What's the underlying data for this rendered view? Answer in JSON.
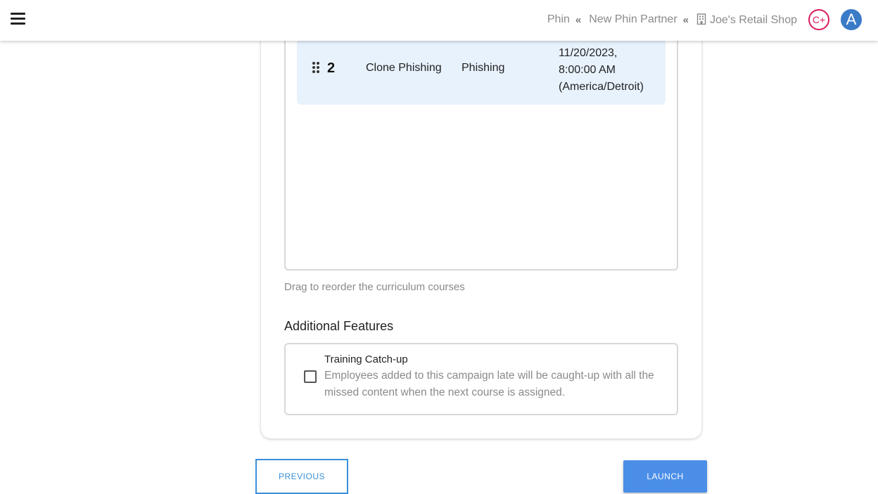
{
  "header": {
    "breadcrumb": [
      {
        "label": "Phin"
      },
      {
        "label": "New Phin Partner"
      },
      {
        "label": "Joe's Retail Shop",
        "icon": "building-icon"
      }
    ],
    "separator": "«",
    "cplus_label": "C+",
    "avatar_initial": "A",
    "colors": {
      "cplus": "#d81b60",
      "avatar": "#3a7bc8"
    }
  },
  "curriculum": {
    "rows": [
      {
        "number": "2",
        "name": "Clone Phishing",
        "type": "Phishing",
        "date_lines": [
          "11/20/2023,",
          "8:00:00 AM",
          "(America/Detroit)"
        ]
      }
    ],
    "hint": "Drag to reorder the curriculum courses"
  },
  "additional_features": {
    "title": "Additional Features",
    "features": [
      {
        "title": "Training Catch-up",
        "description": "Employees added to this campaign late will be caught-up with all the missed content when the next course is assigned.",
        "checked": false
      }
    ]
  },
  "actions": {
    "previous_label": "PREVIOUS",
    "launch_label": "LAUNCH",
    "colors": {
      "primary": "#4a8ee8",
      "outline": "#3a8fd8"
    }
  }
}
